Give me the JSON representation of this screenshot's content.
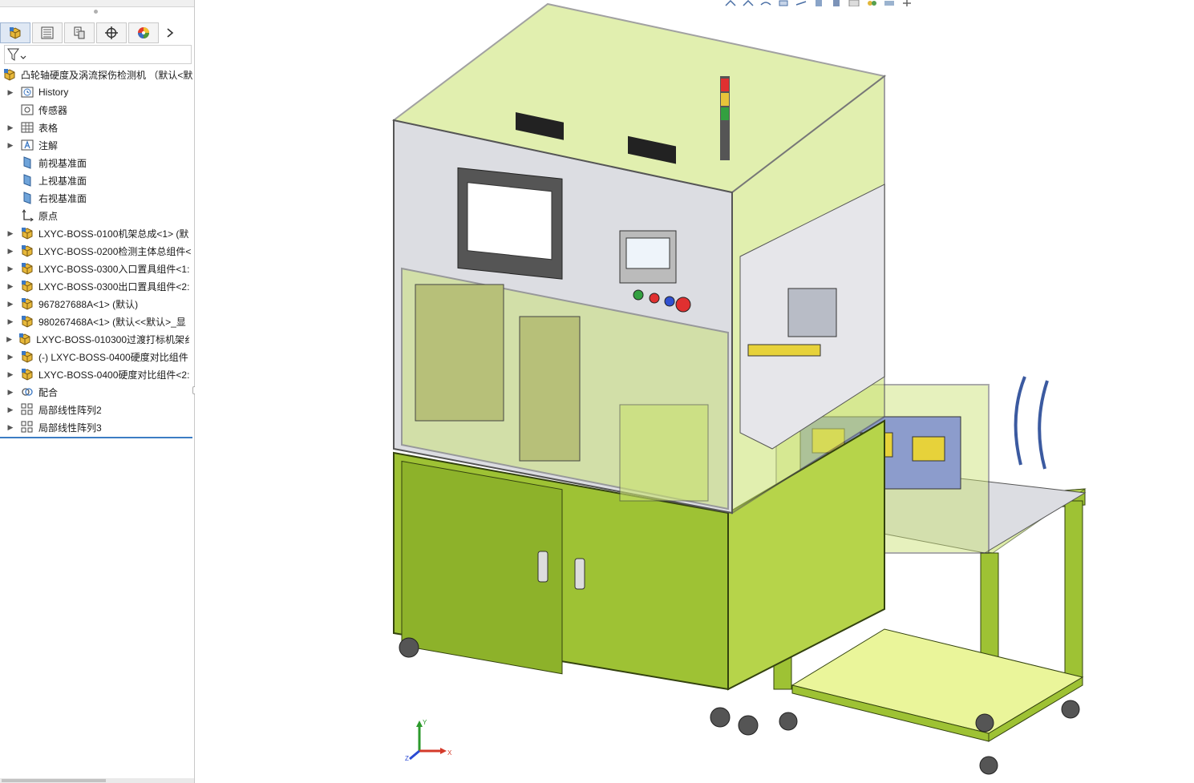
{
  "tree": {
    "root_label": "凸轮轴硬度及涡流探伤检测机 （默认<默",
    "items": [
      {
        "label": "History",
        "icon": "history-icon",
        "expandable": true
      },
      {
        "label": "传感器",
        "icon": "sensor-icon",
        "expandable": false
      },
      {
        "label": "表格",
        "icon": "table-icon",
        "expandable": true
      },
      {
        "label": "注解",
        "icon": "annotation-icon",
        "expandable": true
      },
      {
        "label": "前视基准面",
        "icon": "plane-icon",
        "expandable": false
      },
      {
        "label": "上视基准面",
        "icon": "plane-icon",
        "expandable": false
      },
      {
        "label": "右视基准面",
        "icon": "plane-icon",
        "expandable": false
      },
      {
        "label": "原点",
        "icon": "origin-icon",
        "expandable": false
      },
      {
        "label": "LXYC-BOSS-0100机架总成<1> (默",
        "icon": "assembly-icon",
        "expandable": true
      },
      {
        "label": "LXYC-BOSS-0200检测主体总组件<",
        "icon": "assembly-icon",
        "expandable": true
      },
      {
        "label": "LXYC-BOSS-0300入口置具组件<1:",
        "icon": "assembly-icon",
        "expandable": true
      },
      {
        "label": "LXYC-BOSS-0300出口置具组件<2:",
        "icon": "assembly-icon",
        "expandable": true
      },
      {
        "label": "967827688A<1> (默认)",
        "icon": "assembly-icon",
        "expandable": true
      },
      {
        "label": "980267468A<1> (默认<<默认>_显",
        "icon": "assembly-icon",
        "expandable": true
      },
      {
        "label": "LXYC-BOSS-010300过渡打标机架纟",
        "icon": "assembly-icon",
        "expandable": true
      },
      {
        "label": "(-) LXYC-BOSS-0400硬度对比组件",
        "icon": "assembly-icon",
        "expandable": true
      },
      {
        "label": "LXYC-BOSS-0400硬度对比组件<2:",
        "icon": "assembly-icon",
        "expandable": true
      },
      {
        "label": "配合",
        "icon": "mates-icon",
        "expandable": true
      },
      {
        "label": "局部线性阵列2",
        "icon": "pattern-icon",
        "expandable": true
      },
      {
        "label": "局部线性阵列3",
        "icon": "pattern-icon",
        "expandable": true
      }
    ]
  },
  "tabs": [
    {
      "name": "feature-manager-tab",
      "icon": "feature-manager-icon"
    },
    {
      "name": "property-manager-tab",
      "icon": "property-manager-icon"
    },
    {
      "name": "configuration-manager-tab",
      "icon": "configuration-manager-icon"
    },
    {
      "name": "dimxpert-tab",
      "icon": "crosshair-icon"
    },
    {
      "name": "display-manager-tab",
      "icon": "color-wheel-icon"
    }
  ],
  "triad": {
    "x": "X",
    "y": "Y",
    "z": "Z"
  },
  "colors": {
    "frame_green": "#9ec234",
    "glass_green": "#c9e26f",
    "aluminum": "#c8ccd2",
    "panel_gray": "#dcdde2",
    "selection_blue": "#3c7dc4"
  }
}
